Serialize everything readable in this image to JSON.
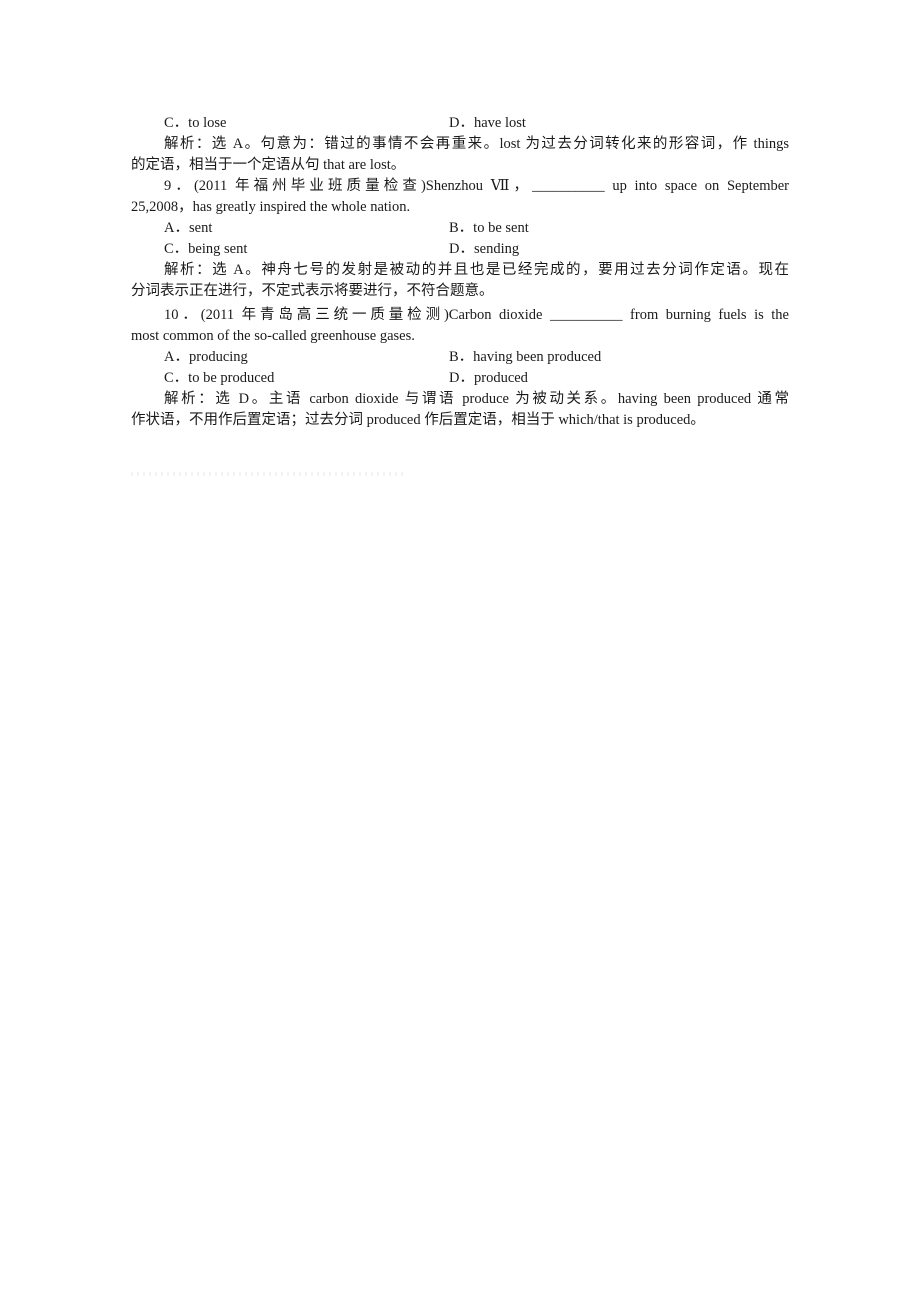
{
  "document": {
    "q8_tail": {
      "options": [
        {
          "letter": "C．",
          "text": "to lose"
        },
        {
          "letter": "D．",
          "text": "have lost"
        }
      ],
      "analysis_line1": "解析：选 A。句意为：错过的事情不会再重来。lost 为过去分词转化来的形容词，作 things",
      "analysis_line2": "的定语，相当于一个定语从句 that are lost。"
    },
    "q9": {
      "stem_line1": "9．(2011 年福州毕业班质量检查)Shenzhou Ⅶ，__________ up into space on September",
      "stem_line2": "25,2008，has greatly inspired the whole nation.",
      "options": [
        {
          "letter": "A．",
          "text": "sent"
        },
        {
          "letter": "B．",
          "text": "to be sent"
        },
        {
          "letter": "C．",
          "text": "being sent"
        },
        {
          "letter": "D．",
          "text": "sending"
        }
      ],
      "analysis_line1": "解析：选 A。神舟七号的发射是被动的并且也是已经完成的，要用过去分词作定语。现在",
      "analysis_line2": "分词表示正在进行，不定式表示将要进行，不符合题意。"
    },
    "q10": {
      "stem_line1": "10．(2011 年青岛高三统一质量检测)Carbon dioxide __________ from burning fuels is the",
      "stem_line2": "most common of the so-called greenhouse gases.",
      "options": [
        {
          "letter": "A．",
          "text": "producing"
        },
        {
          "letter": "B．",
          "text": "having been produced"
        },
        {
          "letter": "C．",
          "text": "to be produced"
        },
        {
          "letter": "D．",
          "text": "produced"
        }
      ],
      "analysis_line1": "解析：选 D。主语 carbon dioxide 与谓语 produce 为被动关系。having been produced 通常",
      "analysis_line2": "作状语，不用作后置定语；过去分词 produced 作后置定语，相当于 which/that is produced。"
    }
  }
}
